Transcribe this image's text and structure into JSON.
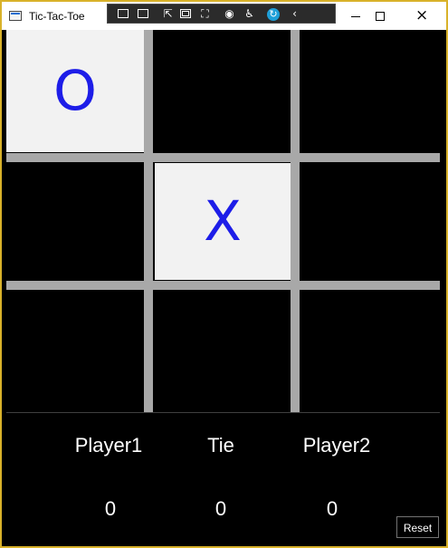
{
  "window": {
    "title": "Tic-Tac-Toe",
    "icon": "app-window-icon",
    "accent_color": "#d9b22a"
  },
  "debug_toolbar": {
    "icons": [
      "live-tree-icon",
      "video-icon",
      "select-element-icon",
      "display-layout-adorners-icon",
      "track-focus-icon",
      "binding-failures-icon",
      "accessibility-icon",
      "hot-reload-icon",
      "collapse-arrow-icon"
    ]
  },
  "board": {
    "cells": [
      {
        "mark": "O",
        "filled": true
      },
      {
        "mark": "",
        "filled": false
      },
      {
        "mark": "",
        "filled": false
      },
      {
        "mark": "",
        "filled": false
      },
      {
        "mark": "X",
        "filled": true
      },
      {
        "mark": "",
        "filled": false
      },
      {
        "mark": "",
        "filled": false
      },
      {
        "mark": "",
        "filled": false
      },
      {
        "mark": "",
        "filled": false
      }
    ],
    "mark_color": "#1d1de8",
    "filled_cell_color": "#f2f2f2",
    "grid_color": "#a8a8a8"
  },
  "scoreboard": {
    "player1_label": "Player1",
    "tie_label": "Tie",
    "player2_label": "Player2",
    "player1_score": "0",
    "tie_score": "0",
    "player2_score": "0"
  },
  "controls": {
    "reset_label": "Reset"
  }
}
